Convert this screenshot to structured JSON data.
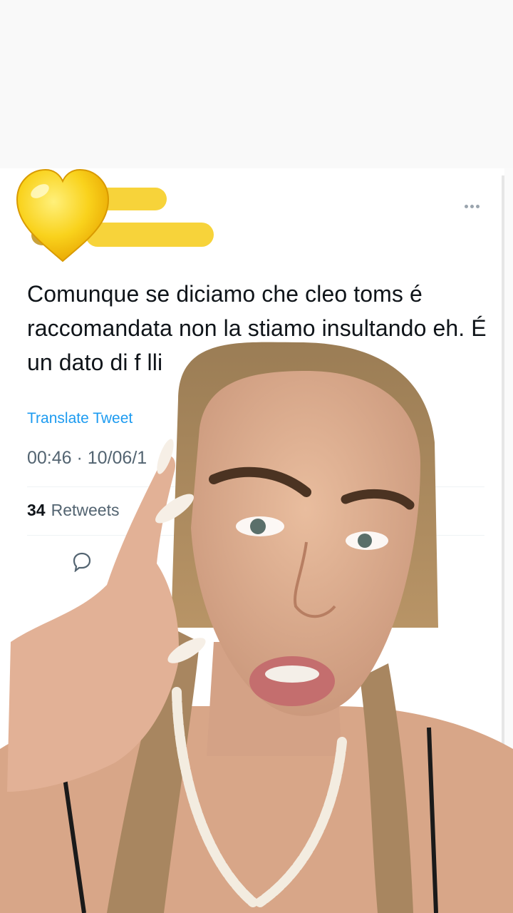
{
  "tweet": {
    "text": "Comunque se diciamo che cleo toms é raccomandata non la stiamo insultando eh. É un dato di f              lli",
    "translate_label": "Translate Tweet",
    "timestamp": "00:46 · 10/06/1",
    "retweets_count": "34",
    "retweets_label": "Retweets"
  },
  "overlay": {
    "sticker": "yellow-heart-emoji",
    "redaction_color": "#f7d12f"
  },
  "colors": {
    "link": "#1d9bf0",
    "text": "#0f1419",
    "muted": "#536471"
  }
}
